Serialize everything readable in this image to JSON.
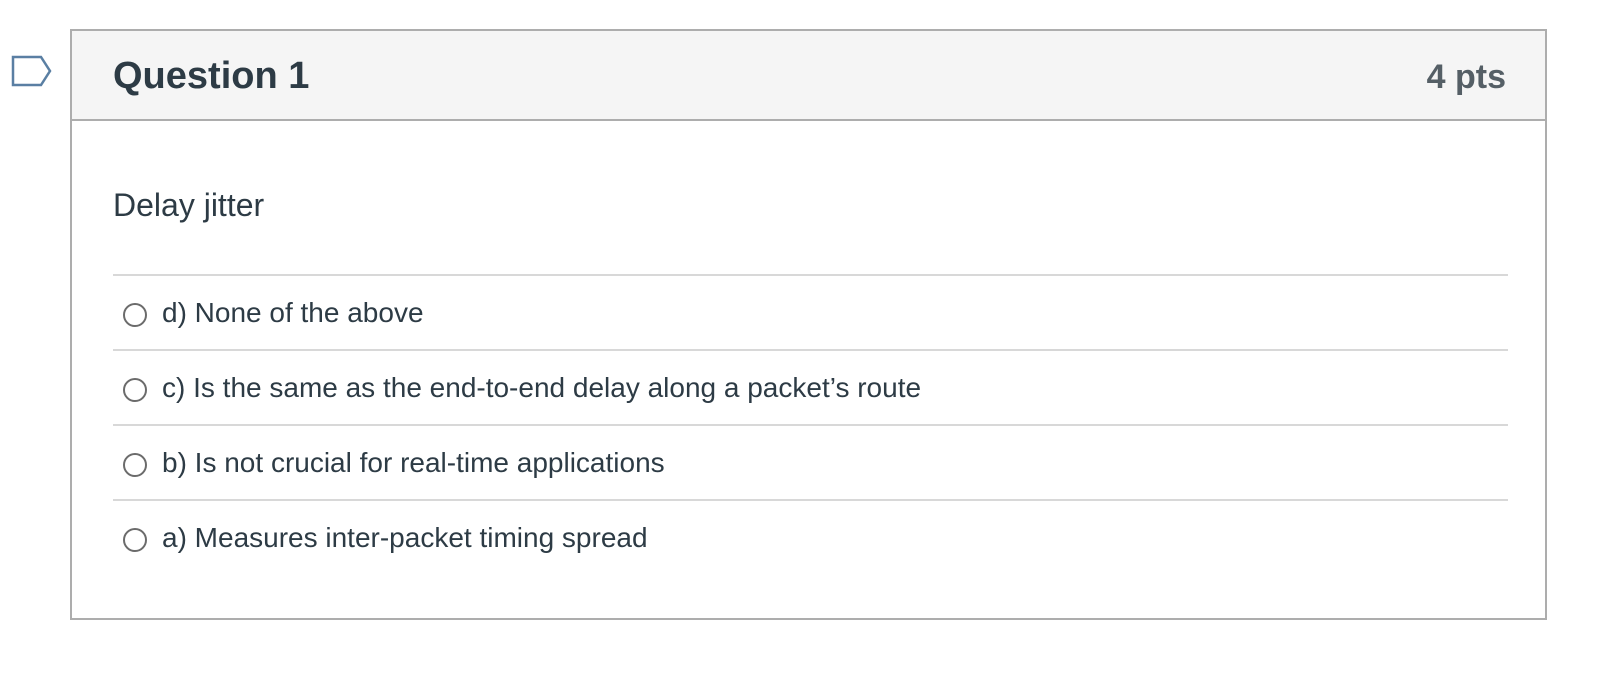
{
  "question": {
    "title": "Question 1",
    "points": "4 pts",
    "text": "Delay jitter",
    "answers": [
      {
        "label": "d) None of the above",
        "selected": false
      },
      {
        "label": "c) Is the same as the end-to-end delay along a packet’s route",
        "selected": false
      },
      {
        "label": "b) Is not crucial for real-time applications",
        "selected": false
      },
      {
        "label": "a) Measures inter-packet timing spread",
        "selected": false
      }
    ]
  },
  "icons": {
    "flag": "bookmark-flag-icon",
    "radio": "radio-unchecked-icon"
  },
  "colors": {
    "flag_stroke": "#5a7fa3",
    "header_bg": "#f5f5f5",
    "border": "#adadad",
    "divider": "#d8d8d8",
    "text": "#2d3b45",
    "points_text": "#555f66"
  }
}
